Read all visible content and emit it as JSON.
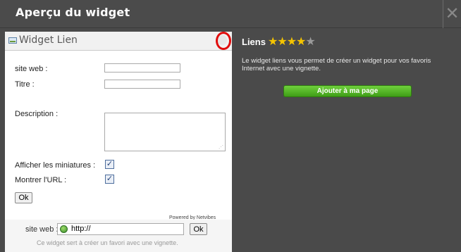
{
  "window": {
    "title": "Aperçu du widget",
    "close_glyph": "✕"
  },
  "widget": {
    "title": "Widget Lien",
    "icon": "widget-icon",
    "form": {
      "site_web_label": "site web :",
      "site_web_value": "",
      "titre_label": "Titre :",
      "titre_value": "",
      "description_label": "Description :",
      "description_value": "",
      "miniatures_label": "Afficher les miniatures :",
      "miniatures_checked": true,
      "url_label": "Montrer l'URL :",
      "url_checked": true,
      "ok_label": "Ok"
    },
    "powered_by": "Powered by Netvibes",
    "footer": {
      "site_label": "site web :",
      "url_value": "http://",
      "ok_label": "Ok",
      "note": "Ce widget sert à créer un favori avec une vignette."
    }
  },
  "info": {
    "name": "Liens",
    "rating": 4,
    "rating_max": 5,
    "description": "Le widget liens vous permet de créer un widget pour vos favoris Internet avec une vignette.",
    "add_button": "Ajouter à ma page",
    "accent_color": "#4fb41f"
  },
  "annotation": {
    "highlight_color": "#e10d0d"
  }
}
